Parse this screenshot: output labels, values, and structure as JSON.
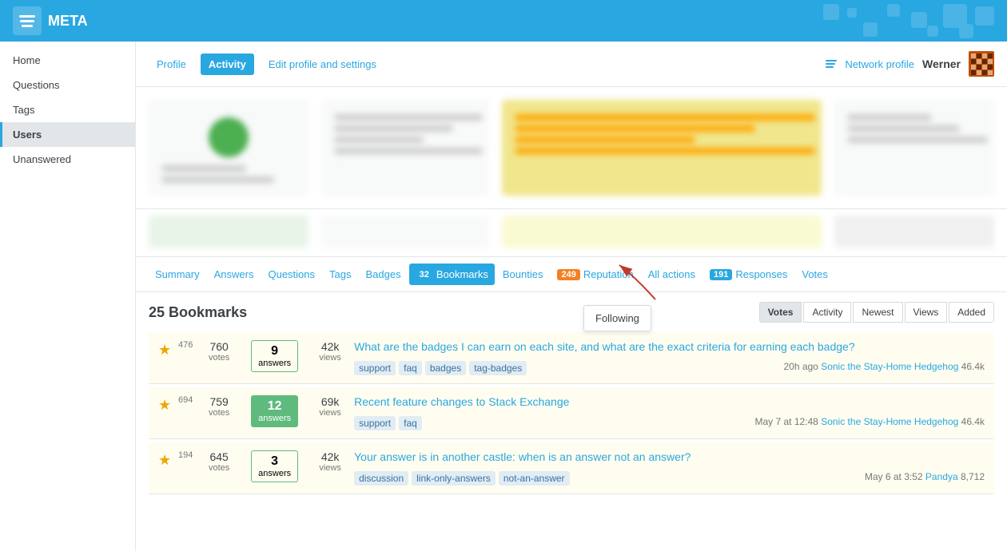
{
  "site": {
    "name": "META"
  },
  "header": {
    "network_profile_label": "Network profile",
    "username": "Werner"
  },
  "sidebar": {
    "items": [
      {
        "id": "home",
        "label": "Home"
      },
      {
        "id": "questions",
        "label": "Questions"
      },
      {
        "id": "tags",
        "label": "Tags"
      },
      {
        "id": "users",
        "label": "Users",
        "active": true
      },
      {
        "id": "unanswered",
        "label": "Unanswered"
      }
    ]
  },
  "top_tabs": {
    "items": [
      {
        "id": "profile",
        "label": "Profile"
      },
      {
        "id": "activity",
        "label": "Activity",
        "active": true
      },
      {
        "id": "edit",
        "label": "Edit profile and settings"
      }
    ]
  },
  "nav_tabs": {
    "items": [
      {
        "id": "summary",
        "label": "Summary",
        "badge": null
      },
      {
        "id": "answers",
        "label": "Answers",
        "badge": null
      },
      {
        "id": "questions",
        "label": "Questions",
        "badge": null
      },
      {
        "id": "tags",
        "label": "Tags",
        "badge": null
      },
      {
        "id": "badges",
        "label": "Badges",
        "badge": null
      },
      {
        "id": "bookmarks",
        "label": "Bookmarks",
        "badge": "32",
        "active": true
      },
      {
        "id": "bounties",
        "label": "Bounties",
        "badge": null
      },
      {
        "id": "reputation",
        "label": "Reputation",
        "badge": "249"
      },
      {
        "id": "all_actions",
        "label": "All actions",
        "badge": null
      },
      {
        "id": "responses",
        "label": "Responses",
        "badge": "191"
      },
      {
        "id": "votes",
        "label": "Votes",
        "badge": null
      }
    ]
  },
  "section": {
    "count": "25",
    "title": "Bookmarks",
    "sort_buttons": [
      {
        "id": "votes",
        "label": "Votes",
        "active": true
      },
      {
        "id": "activity",
        "label": "Activity"
      },
      {
        "id": "newest",
        "label": "Newest"
      },
      {
        "id": "views",
        "label": "Views"
      },
      {
        "id": "added",
        "label": "Added"
      }
    ]
  },
  "tooltip": {
    "label": "Following"
  },
  "questions": [
    {
      "bookmark_num": "476",
      "votes": "760",
      "votes_label": "votes",
      "answers": "9",
      "answers_label": "answers",
      "answers_accepted": false,
      "views": "42k",
      "views_label": "views",
      "title": "What are the badges I can earn on each site, and what are the exact criteria for earning each badge?",
      "tags": [
        "support",
        "faq",
        "badges",
        "tag-badges"
      ],
      "meta_time": "20h ago",
      "meta_user": "Sonic the Stay-Home Hedgehog",
      "meta_rep": "46.4k"
    },
    {
      "bookmark_num": "694",
      "votes": "759",
      "votes_label": "votes",
      "answers": "12",
      "answers_label": "answers",
      "answers_accepted": true,
      "views": "69k",
      "views_label": "views",
      "title": "Recent feature changes to Stack Exchange",
      "tags": [
        "support",
        "faq"
      ],
      "meta_time": "May 7 at 12:48",
      "meta_user": "Sonic the Stay-Home Hedgehog",
      "meta_rep": "46.4k"
    },
    {
      "bookmark_num": "194",
      "votes": "645",
      "votes_label": "votes",
      "answers": "3",
      "answers_label": "answers",
      "answers_accepted": false,
      "views": "42k",
      "views_label": "views",
      "title": "Your answer is in another castle: when is an answer not an answer?",
      "tags": [
        "discussion",
        "link-only-answers",
        "not-an-answer"
      ],
      "meta_time": "May 6 at 3:52",
      "meta_user": "Pandya",
      "meta_rep": "8,712"
    }
  ]
}
